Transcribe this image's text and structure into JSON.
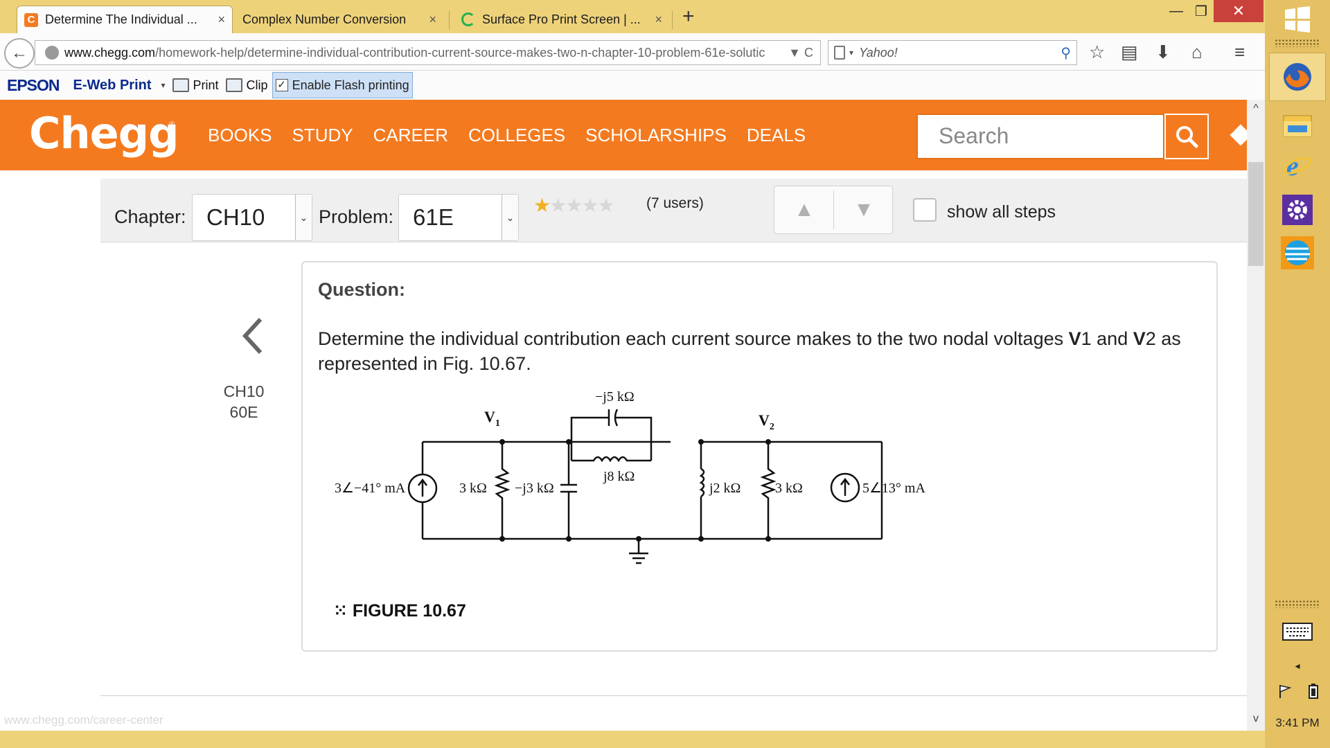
{
  "browser": {
    "tabs": [
      {
        "title": "Determine The Individual ...",
        "close": "×"
      },
      {
        "title": "Complex Number Conversion",
        "close": "×"
      },
      {
        "title": "Surface Pro Print Screen | ...",
        "close": "×"
      }
    ],
    "new_tab": "+",
    "window_controls": {
      "minimize": "—",
      "restore": "❐",
      "close": "✕"
    },
    "back": "←",
    "url_host": "www.chegg.com",
    "url_path": "/homework-help/determine-individual-contribution-current-source-makes-two-n-chapter-10-problem-61e-solutic",
    "url_tools": "▼ C",
    "search_engine": "Yahoo!",
    "search_caret": "▾",
    "search_go": "⚲",
    "nav_icons": {
      "bookmark_star": "☆",
      "reading_list": "▤",
      "download": "⬇",
      "home": "⌂",
      "menu": "≡"
    }
  },
  "epson_bar": {
    "brand": "EPSON",
    "product": "E-Web Print",
    "dropdown": "▾",
    "print": "Print",
    "clip": "Clip",
    "flash_check": "✓",
    "flash_label": "Enable Flash printing"
  },
  "chegg": {
    "logo": "Chegg",
    "reg": "®",
    "nav": [
      "BOOKS",
      "STUDY",
      "CAREER",
      "COLLEGES",
      "SCHOLARSHIPS",
      "DEALS"
    ],
    "search_placeholder": "Search"
  },
  "toolbar": {
    "chapter_label": "Chapter:",
    "chapter_value": "CH10",
    "problem_label": "Problem:",
    "problem_value": "61E",
    "select_arrow": "⌄",
    "rating_stars_filled": 1,
    "rating_stars_total": 5,
    "rating_filled_glyph": "★",
    "rating_empty_glyphs": "★★★★",
    "rating_count": "(7 users)",
    "vote_up": "▲",
    "vote_down": "▼",
    "show_steps_label": "show all steps"
  },
  "content": {
    "prev_chapter": "CH10",
    "prev_problem": "60E",
    "question_heading": "Question:",
    "question_pre": "Determine the individual contribution each current source makes to the two nodal voltages ",
    "question_v1": "V",
    "question_v1_sub": "1",
    "question_mid": " and ",
    "question_v2": "V",
    "question_v2_sub": "2",
    "question_post": " as represented in Fig. 10.67.",
    "figure": {
      "caption": "FIGURE 10.67",
      "caption_mark": "⁙",
      "node1": "V",
      "node1_sub": "1",
      "node2": "V",
      "node2_sub": "2",
      "cap_top": "−j5 kΩ",
      "ind_mid": "j8 kΩ",
      "src_left": "3∠−41° mA",
      "r1": "3 kΩ",
      "c1": "−j3 kΩ",
      "l2": "j2 kΩ",
      "r2": "3 kΩ",
      "src_right": "5∠13° mA"
    }
  },
  "status_bar_url": "www.chegg.com/career-center",
  "scrollbar": {
    "up": "^",
    "down": "v"
  },
  "taskbar": {
    "clock": "3:41 PM",
    "tray_arrow": "◂"
  }
}
